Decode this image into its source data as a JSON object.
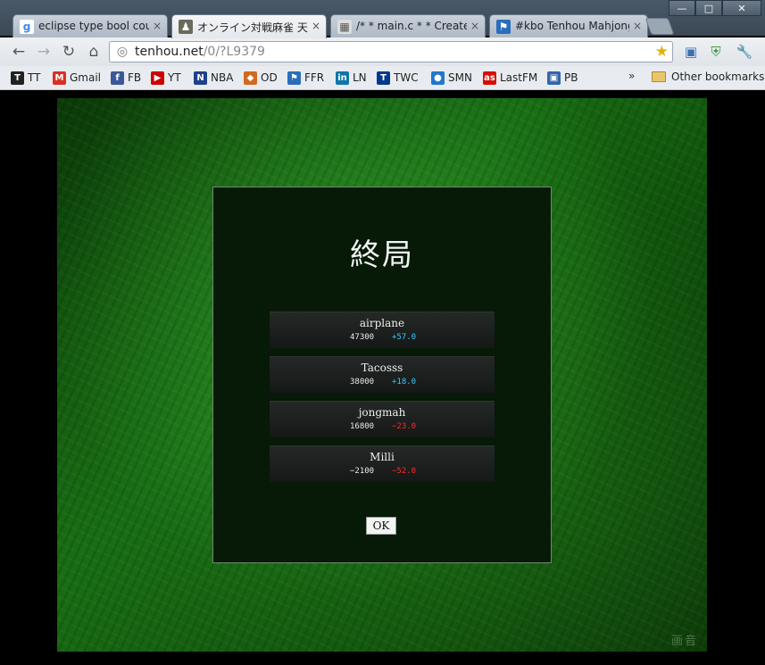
{
  "window": {
    "tabs": [
      {
        "title": "eclipse type bool could r",
        "icon": "google-icon",
        "active": false
      },
      {
        "title": "オンライン対戦麻雀 天鳳",
        "icon": "tenhou-icon",
        "active": true
      },
      {
        "title": "/* * main.c * * Created o",
        "icon": "document-icon",
        "active": false
      },
      {
        "title": "#kbo Tenhou Mahjong L",
        "icon": "kbo-icon",
        "active": false
      }
    ],
    "close_glyph": "×",
    "controls": {
      "minimize": "—",
      "maximize": "□",
      "close": "✕"
    }
  },
  "toolbar": {
    "url_host": "tenhou.net",
    "url_path": "/0/?L9379"
  },
  "bookmarks": {
    "items": [
      {
        "label": "TT",
        "icon": "tt-icon",
        "color": "#222222"
      },
      {
        "label": "Gmail",
        "icon": "gmail-icon",
        "color": "#d93025"
      },
      {
        "label": "FB",
        "icon": "facebook-icon",
        "color": "#3b5998"
      },
      {
        "label": "YT",
        "icon": "youtube-icon",
        "color": "#cc0000"
      },
      {
        "label": "NBA",
        "icon": "nba-icon",
        "color": "#1d428a"
      },
      {
        "label": "OD",
        "icon": "od-icon",
        "color": "#d2691e"
      },
      {
        "label": "FFR",
        "icon": "ffr-icon",
        "color": "#2a6ebb"
      },
      {
        "label": "LN",
        "icon": "linkedin-icon",
        "color": "#0e76a8"
      },
      {
        "label": "TWC",
        "icon": "twc-icon",
        "color": "#003a8c"
      },
      {
        "label": "SMN",
        "icon": "smn-icon",
        "color": "#2277cc"
      },
      {
        "label": "LastFM",
        "icon": "lastfm-icon",
        "color": "#d51007"
      },
      {
        "label": "PB",
        "icon": "pb-icon",
        "color": "#3366aa"
      }
    ],
    "more": "»",
    "other": "Other bookmarks"
  },
  "game": {
    "title": "終局",
    "results": [
      {
        "name": "airplane",
        "score": "47300",
        "delta": "+57.0",
        "delta_color": "#33c9ff"
      },
      {
        "name": "Tacosss",
        "score": "38000",
        "delta": "+18.0",
        "delta_color": "#33c9ff"
      },
      {
        "name": "jongmah",
        "score": "16800",
        "delta": "−23.0",
        "delta_color": "#ff2a2a"
      },
      {
        "name": "Milli",
        "score": "−2100",
        "delta": "−52.0",
        "delta_color": "#ff2a2a"
      }
    ],
    "ok_label": "OK",
    "watermark": "画音"
  }
}
